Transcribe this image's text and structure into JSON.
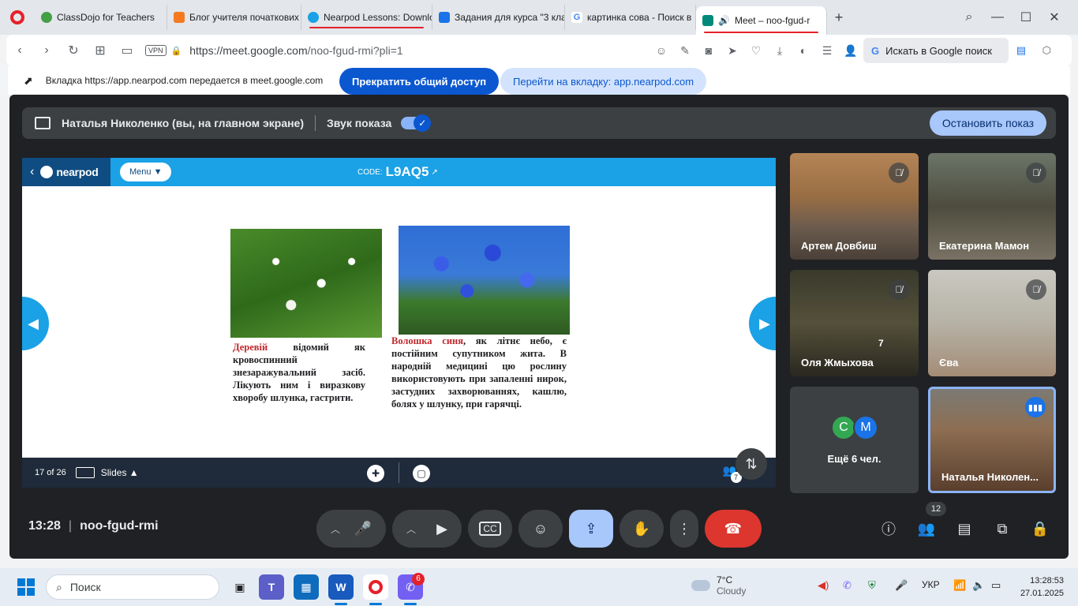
{
  "browser": {
    "tabs": [
      {
        "title": "ClassDojo for Teachers",
        "color": "#43a047"
      },
      {
        "title": "Блог учителя початкових",
        "color": "#f4791f"
      },
      {
        "title": "Nearpod Lessons: Downlo",
        "color": "#1aa1e6"
      },
      {
        "title": "Задания для курса \"3 кла",
        "color": "#1a73e8"
      },
      {
        "title": "картинка сова - Поиск в",
        "color": "#4285f4"
      },
      {
        "title": "Meet – noo-fgud-r",
        "color": "#00897b"
      }
    ],
    "new_tab": "+",
    "vpn_label": "VPN",
    "url_host": "https://meet.google.com",
    "url_path": "/noo-fgud-rmi?pli=1",
    "google_search": "Искать в Google поиск"
  },
  "sharebar": {
    "text": "Вкладка https://app.nearpod.com передается в meet.google.com",
    "stop_label": "Прекратить общий доступ",
    "goto_label": "Перейти на вкладку: app.nearpod.com"
  },
  "presenting": {
    "name": "Наталья Николенко (вы, на главном экране)",
    "sound_label": "Звук показа",
    "stop_label": "Остановить показ"
  },
  "nearpod": {
    "logo": "nearpod",
    "menu_label": "Menu ▼",
    "code_label": "CODE:",
    "code_value": "L9AQ5",
    "slide": {
      "text1_title": "Деревій",
      "text1_body": " відомий як кровоспинний знезаражувальний засіб. Лікують ним і виразкову хворобу шлунка, гастрити.",
      "text2_title": "Волошка синя",
      "text2_body": ", як літнє небо, є постійним супутником жита. В народній медицині цю рослину використовують при запаленні нирок, застудних захворюваннях, кашлю, болях у шлунку, при гарячці."
    },
    "page_counter": "17 of 26",
    "slides_label": "Slides ▲",
    "students_count": "7"
  },
  "participants": [
    {
      "name": "Артем Довбиш",
      "muted": true
    },
    {
      "name": "Екатерина Мамон",
      "muted": true
    },
    {
      "name": "Оля Жмыхова",
      "muted": true,
      "overlay": "7"
    },
    {
      "name": "Єва",
      "muted": true
    },
    {
      "name": "Наталья Николен...",
      "speaking": true
    }
  ],
  "more": {
    "avatar1": "С",
    "avatar2": "М",
    "label": "Ещё 6 чел."
  },
  "meet_bottom": {
    "time": "13:28",
    "separator": "|",
    "meeting_code": "noo-fgud-rmi",
    "people_count": "12"
  },
  "taskbar": {
    "search_placeholder": "Поиск",
    "viber_badge": "6",
    "weather_temp": "7°C",
    "weather_desc": "Cloudy",
    "lang": "УКР",
    "time": "13:28:53",
    "date": "27.01.2025"
  }
}
